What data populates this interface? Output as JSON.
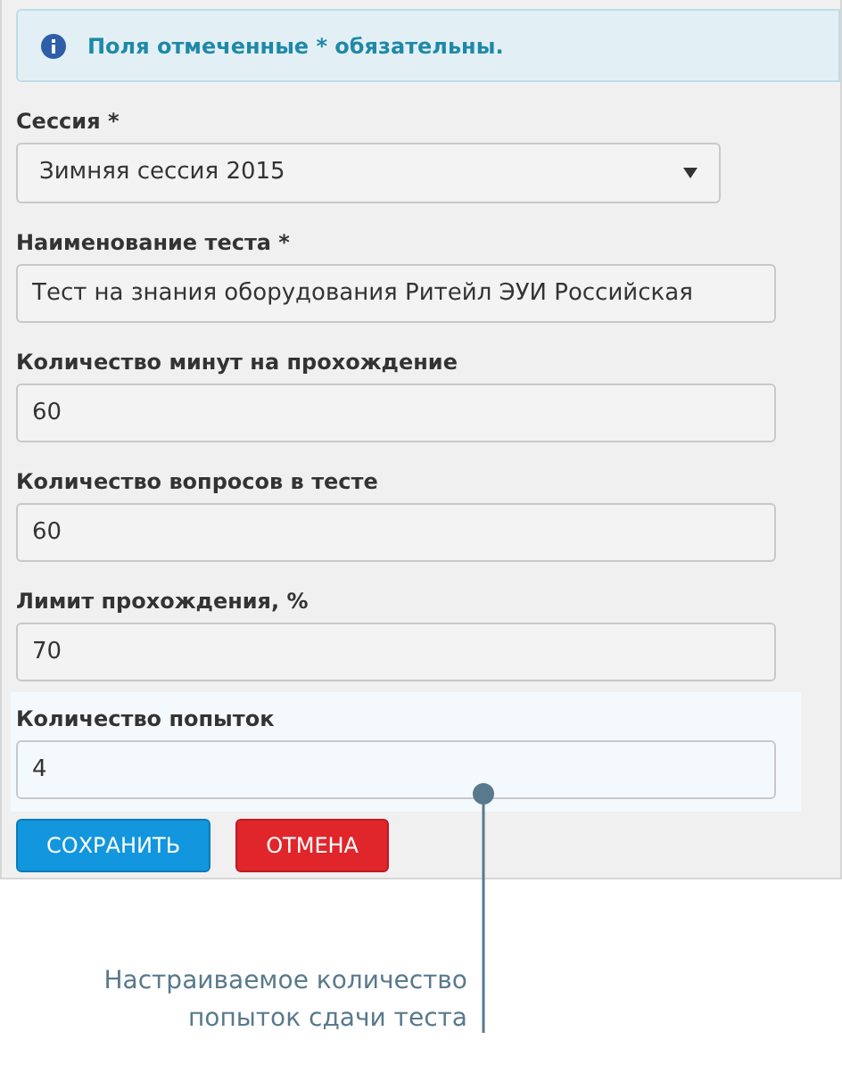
{
  "notice": {
    "text": "Поля отмеченные * обязательны."
  },
  "fields": [
    {
      "kind": "select",
      "label": "Сессия *",
      "value": "Зимняя сессия 2015",
      "highlighted": false
    },
    {
      "kind": "text",
      "label": "Наименование теста *",
      "value": "Тест на знания оборудования Ритейл ЭУИ Российская",
      "highlighted": false
    },
    {
      "kind": "text",
      "label": "Количество минут на прохождение",
      "value": "60",
      "highlighted": false
    },
    {
      "kind": "text",
      "label": "Количество вопросов в тесте",
      "value": "60",
      "highlighted": false
    },
    {
      "kind": "text",
      "label": "Лимит прохождения, %",
      "value": "70",
      "highlighted": false
    },
    {
      "kind": "text",
      "label": "Количество попыток",
      "value": "4",
      "highlighted": true
    }
  ],
  "buttons": [
    {
      "kind": "primary",
      "label": "СОХРАНИТЬ"
    },
    {
      "kind": "danger",
      "label": "ОТМЕНА"
    }
  ],
  "callout": {
    "lines": [
      "Настраиваемое количество",
      "попыток сдачи теста"
    ]
  }
}
